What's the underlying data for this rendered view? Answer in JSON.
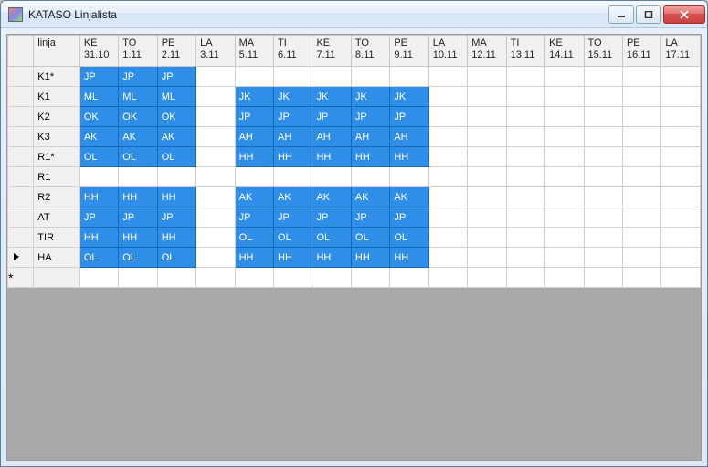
{
  "window": {
    "title": "KATASO Linjalista"
  },
  "grid": {
    "linja_header": "linja",
    "columns": [
      {
        "dow": "KE",
        "date": "31.10"
      },
      {
        "dow": "TO",
        "date": "1.11"
      },
      {
        "dow": "PE",
        "date": "2.11"
      },
      {
        "dow": "LA",
        "date": "3.11"
      },
      {
        "dow": "MA",
        "date": "5.11"
      },
      {
        "dow": "TI",
        "date": "6.11"
      },
      {
        "dow": "KE",
        "date": "7.11"
      },
      {
        "dow": "TO",
        "date": "8.11"
      },
      {
        "dow": "PE",
        "date": "9.11"
      },
      {
        "dow": "LA",
        "date": "10.11"
      },
      {
        "dow": "MA",
        "date": "12.11"
      },
      {
        "dow": "TI",
        "date": "13.11"
      },
      {
        "dow": "KE",
        "date": "14.11"
      },
      {
        "dow": "TO",
        "date": "15.11"
      },
      {
        "dow": "PE",
        "date": "16.11"
      },
      {
        "dow": "LA",
        "date": "17.11"
      }
    ],
    "rows": [
      {
        "linja": "K1*",
        "cells": [
          "JP",
          "JP",
          "JP",
          "",
          "",
          "",
          "",
          "",
          "",
          "",
          "",
          "",
          "",
          "",
          "",
          ""
        ],
        "sel": [
          1,
          1,
          1,
          0,
          0,
          0,
          0,
          0,
          0,
          0,
          0,
          0,
          0,
          0,
          0,
          0
        ],
        "indicator": ""
      },
      {
        "linja": "K1",
        "cells": [
          "ML",
          "ML",
          "ML",
          "",
          "JK",
          "JK",
          "JK",
          "JK",
          "JK",
          "",
          "",
          "",
          "",
          "",
          "",
          ""
        ],
        "sel": [
          1,
          1,
          1,
          0,
          1,
          1,
          1,
          1,
          1,
          0,
          0,
          0,
          0,
          0,
          0,
          0
        ],
        "indicator": ""
      },
      {
        "linja": "K2",
        "cells": [
          "OK",
          "OK",
          "OK",
          "",
          "JP",
          "JP",
          "JP",
          "JP",
          "JP",
          "",
          "",
          "",
          "",
          "",
          "",
          ""
        ],
        "sel": [
          1,
          1,
          1,
          0,
          1,
          1,
          1,
          1,
          1,
          0,
          0,
          0,
          0,
          0,
          0,
          0
        ],
        "indicator": ""
      },
      {
        "linja": "K3",
        "cells": [
          "AK",
          "AK",
          "AK",
          "",
          "AH",
          "AH",
          "AH",
          "AH",
          "AH",
          "",
          "",
          "",
          "",
          "",
          "",
          ""
        ],
        "sel": [
          1,
          1,
          1,
          0,
          1,
          1,
          1,
          1,
          1,
          0,
          0,
          0,
          0,
          0,
          0,
          0
        ],
        "indicator": ""
      },
      {
        "linja": "R1*",
        "cells": [
          "OL",
          "OL",
          "OL",
          "",
          "HH",
          "HH",
          "HH",
          "HH",
          "HH",
          "",
          "",
          "",
          "",
          "",
          "",
          ""
        ],
        "sel": [
          1,
          1,
          1,
          0,
          1,
          1,
          1,
          1,
          1,
          0,
          0,
          0,
          0,
          0,
          0,
          0
        ],
        "indicator": ""
      },
      {
        "linja": "R1",
        "cells": [
          "",
          "",
          "",
          "",
          "",
          "",
          "",
          "",
          "",
          "",
          "",
          "",
          "",
          "",
          "",
          ""
        ],
        "sel": [
          0,
          0,
          0,
          0,
          0,
          0,
          0,
          0,
          0,
          0,
          0,
          0,
          0,
          0,
          0,
          0
        ],
        "indicator": ""
      },
      {
        "linja": "R2",
        "cells": [
          "HH",
          "HH",
          "HH",
          "",
          "AK",
          "AK",
          "AK",
          "AK",
          "AK",
          "",
          "",
          "",
          "",
          "",
          "",
          ""
        ],
        "sel": [
          1,
          1,
          1,
          0,
          1,
          1,
          1,
          1,
          1,
          0,
          0,
          0,
          0,
          0,
          0,
          0
        ],
        "indicator": ""
      },
      {
        "linja": "AT",
        "cells": [
          "JP",
          "JP",
          "JP",
          "",
          "JP",
          "JP",
          "JP",
          "JP",
          "JP",
          "",
          "",
          "",
          "",
          "",
          "",
          ""
        ],
        "sel": [
          1,
          1,
          1,
          0,
          1,
          1,
          1,
          1,
          1,
          0,
          0,
          0,
          0,
          0,
          0,
          0
        ],
        "indicator": ""
      },
      {
        "linja": "TIR",
        "cells": [
          "HH",
          "HH",
          "HH",
          "",
          "OL",
          "OL",
          "OL",
          "OL",
          "OL",
          "",
          "",
          "",
          "",
          "",
          "",
          ""
        ],
        "sel": [
          1,
          1,
          1,
          0,
          1,
          1,
          1,
          1,
          1,
          0,
          0,
          0,
          0,
          0,
          0,
          0
        ],
        "indicator": ""
      },
      {
        "linja": "HA",
        "cells": [
          "OL",
          "OL",
          "OL",
          "",
          "HH",
          "HH",
          "HH",
          "HH",
          "HH",
          "",
          "",
          "",
          "",
          "",
          "",
          ""
        ],
        "sel": [
          1,
          1,
          1,
          0,
          1,
          1,
          1,
          1,
          1,
          0,
          0,
          0,
          0,
          0,
          0,
          0
        ],
        "indicator": "current"
      },
      {
        "linja": "",
        "cells": [
          "",
          "",
          "",
          "",
          "",
          "",
          "",
          "",
          "",
          "",
          "",
          "",
          "",
          "",
          "",
          ""
        ],
        "sel": [
          0,
          0,
          0,
          0,
          0,
          0,
          0,
          0,
          0,
          0,
          0,
          0,
          0,
          0,
          0,
          0
        ],
        "indicator": "new"
      }
    ]
  }
}
